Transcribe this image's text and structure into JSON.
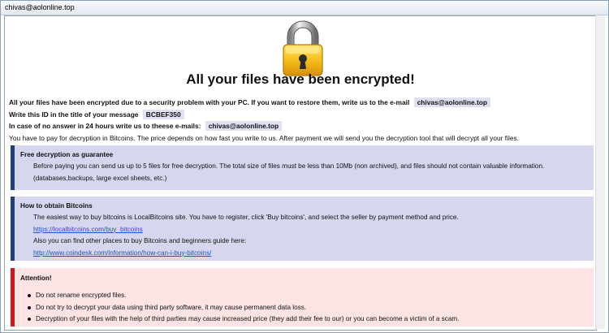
{
  "window": {
    "title": "chivas@aolonline.top"
  },
  "header": {
    "headline": "All your files have been encrypted!"
  },
  "info": {
    "line1_text": "All your files have been encrypted due to a security problem with your PC. If you want to restore them, write us to the e-mail",
    "line1_email": "chivas@aolonline.top",
    "line2_text": "Write this ID in the title of your message",
    "line2_id": "BCBEF350",
    "line3_text": "In case of no answer in 24 hours write us to theese e-mails:",
    "line3_email": "chivas@aolonline.top",
    "line4_text": "You have to pay for decryption in Bitcoins. The price depends on how fast you write to us. After payment we will send you the decryption tool that will decrypt all your files."
  },
  "free_decryption": {
    "heading": "Free decryption as guarantee",
    "text": "Before paying you can send us up to 5 files for free decryption. The total size of files must be less than 10Mb (non archived), and files should not contain valuable information. (databases,backups, large excel sheets, etc.)"
  },
  "bitcoins": {
    "heading": "How to obtain Bitcoins",
    "text1": "The easiest way to buy bitcoins is LocalBitcoins site. You have to register, click 'Buy bitcoins', and select the seller by payment method and price.",
    "link1": "https://localbitcoins.com/buy_bitcoins",
    "text2": "Also you can find other places to buy Bitcoins and beginners guide here:",
    "link2": "http://www.coindesk.com/information/how-can-i-buy-bitcoins/"
  },
  "attention": {
    "heading": "Attention!",
    "items": [
      "Do not rename encrypted files.",
      "Do not try to decrypt your data using third party software, it may cause permanent data loss.",
      "Decryption of your files with the help of third parties may cause increased price (they add their fee to our) or you can become a victim of a scam."
    ]
  },
  "colors": {
    "blue_box_bg": "#d6d7ee",
    "blue_box_bar": "#1f3f7e",
    "red_box_bg": "#fde3e3",
    "red_box_bar": "#d21919",
    "link": "#1a55c8"
  },
  "icons": {
    "lock": "padlock-icon"
  }
}
